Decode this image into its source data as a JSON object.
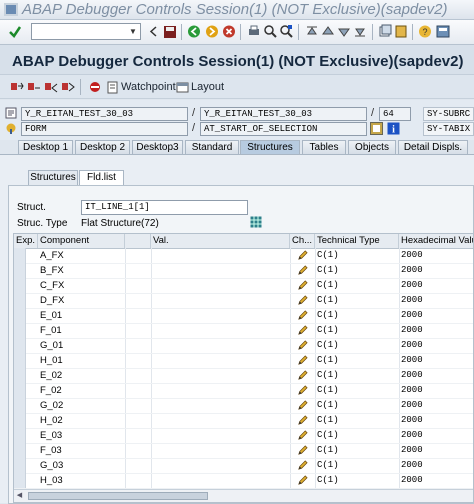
{
  "window": {
    "title": "ABAP Debugger Controls Session(1)  (NOT Exclusive)(sapdev2)"
  },
  "toolbar": {
    "command_value": ""
  },
  "header": {
    "title": "ABAP Debugger Controls Session(1)  (NOT Exclusive)(sapdev2)"
  },
  "app_toolbar": {
    "watchpoint_label": "Watchpoint",
    "layout_label": "Layout"
  },
  "fields": {
    "program": "Y_R_EITAN_TEST_30_03",
    "include": "Y_R_EITAN_TEST_30_03",
    "line": "64",
    "subrc_label": "SY-SUBRC",
    "event_type": "FORM",
    "event": "AT_START_OF_SELECTION",
    "tabix_label": "SY-TABIX"
  },
  "tabs": [
    "Desktop 1",
    "Desktop 2",
    "Desktop3",
    "Standard",
    "Structures",
    "Tables",
    "Objects",
    "Detail Displs."
  ],
  "active_tab": "Structures",
  "subtabs": [
    "Structures",
    "Fld.list"
  ],
  "active_subtab": "Fld.list",
  "struct": {
    "label": "Struct.",
    "value": "IT_LINE_1[1]",
    "type_label": "Struc. Type",
    "type_value": "Flat Structure(72)"
  },
  "table": {
    "headers": [
      "Exp.",
      "Component",
      "",
      "Val.",
      "Ch...",
      "Technical Type",
      "Hexadecimal Value"
    ],
    "rows": [
      {
        "component": "A_FX",
        "tech": "C(1)",
        "hex": "2000"
      },
      {
        "component": "B_FX",
        "tech": "C(1)",
        "hex": "2000"
      },
      {
        "component": "C_FX",
        "tech": "C(1)",
        "hex": "2000"
      },
      {
        "component": "D_FX",
        "tech": "C(1)",
        "hex": "2000"
      },
      {
        "component": "E_01",
        "tech": "C(1)",
        "hex": "2000"
      },
      {
        "component": "F_01",
        "tech": "C(1)",
        "hex": "2000"
      },
      {
        "component": "G_01",
        "tech": "C(1)",
        "hex": "2000"
      },
      {
        "component": "H_01",
        "tech": "C(1)",
        "hex": "2000"
      },
      {
        "component": "E_02",
        "tech": "C(1)",
        "hex": "2000"
      },
      {
        "component": "F_02",
        "tech": "C(1)",
        "hex": "2000"
      },
      {
        "component": "G_02",
        "tech": "C(1)",
        "hex": "2000"
      },
      {
        "component": "H_02",
        "tech": "C(1)",
        "hex": "2000"
      },
      {
        "component": "E_03",
        "tech": "C(1)",
        "hex": "2000"
      },
      {
        "component": "F_03",
        "tech": "C(1)",
        "hex": "2000"
      },
      {
        "component": "G_03",
        "tech": "C(1)",
        "hex": "2000"
      },
      {
        "component": "H_03",
        "tech": "C(1)",
        "hex": "2000"
      }
    ]
  },
  "colors": {
    "accent": "#15283e",
    "title_text": "#7e8fa3",
    "active_tab": "#b7cbe0",
    "error_red": "#c0392b",
    "info_blue": "#1b52c4"
  }
}
